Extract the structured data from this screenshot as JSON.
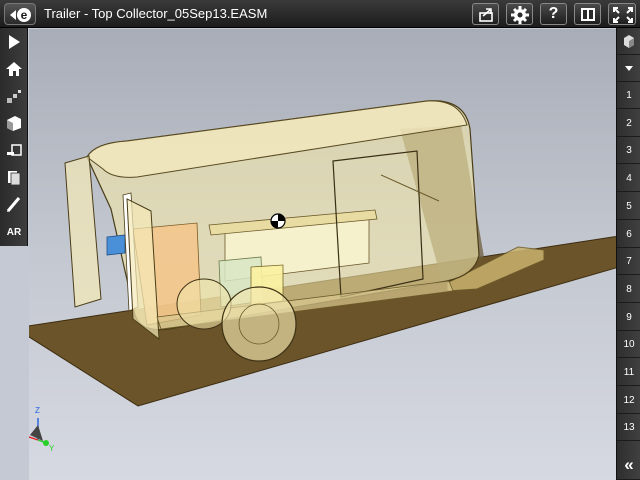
{
  "header": {
    "logo_letter": "e",
    "title": "Trailer - Top Collector_05Sep13.EASM",
    "buttons": [
      {
        "icon": "share-icon"
      },
      {
        "icon": "gear-icon"
      },
      {
        "icon": "help-icon",
        "label": "?"
      },
      {
        "icon": "split-view-icon"
      },
      {
        "icon": "fullscreen-icon"
      }
    ]
  },
  "left_toolbar": {
    "items": [
      {
        "icon": "play-icon"
      },
      {
        "icon": "home-icon"
      },
      {
        "icon": "explode-icon"
      },
      {
        "icon": "section-icon"
      },
      {
        "icon": "measure-icon"
      },
      {
        "icon": "markup-icon"
      },
      {
        "icon": "pen-icon"
      },
      {
        "label": "AR"
      }
    ]
  },
  "right_bar": {
    "top_icon": "views-cube-icon",
    "dropdown_icon": "caret-down-icon",
    "views": [
      "1",
      "2",
      "3",
      "4",
      "5",
      "6",
      "7",
      "8",
      "9",
      "10",
      "11",
      "12",
      "13"
    ],
    "collapse_label": "«"
  },
  "viewport": {
    "model": "trailer-assembly",
    "triad_axes": [
      "Z",
      "X",
      "Y"
    ],
    "colors": {
      "body": "#f2e6a8",
      "ground": "#6b5429",
      "triad_x": "#e02020",
      "triad_y": "#2ad02a",
      "triad_z": "#2060e0"
    }
  }
}
